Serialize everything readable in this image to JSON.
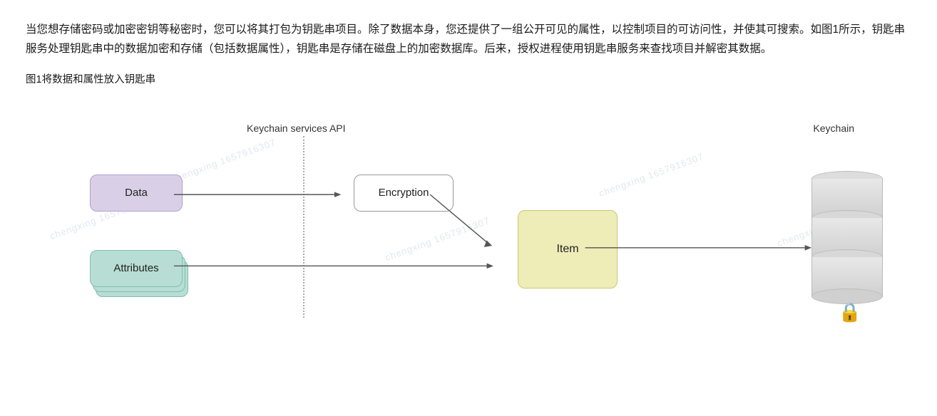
{
  "text_block": {
    "paragraph": "当您想存储密码或加密密钥等秘密时，您可以将其打包为钥匙串项目。除了数据本身，您还提供了一组公开可见的属性，以控制项目的可访问性，并使其可搜索。如图1所示，钥匙串服务处理钥匙串中的数据加密和存储（包括数据属性），钥匙串是存储在磁盘上的加密数据库。后来，授权进程使用钥匙串服务来查找项目并解密其数据。"
  },
  "figure_caption": {
    "text": "图1将数据和属性放入钥匙串"
  },
  "diagram": {
    "api_label": "Keychain services API",
    "keychain_label": "Keychain",
    "data_box_label": "Data",
    "attrs_box_label": "Attributes",
    "encryption_box_label": "Encryption",
    "item_box_label": "Item",
    "watermark_text": "chengxing 1657916307"
  }
}
